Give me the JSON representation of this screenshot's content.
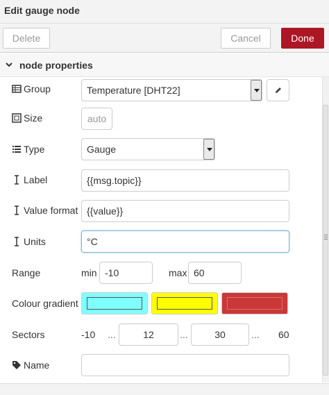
{
  "header": {
    "title": "Edit gauge node"
  },
  "toolbar": {
    "delete_label": "Delete",
    "cancel_label": "Cancel",
    "done_label": "Done"
  },
  "section": {
    "label": "node properties"
  },
  "group": {
    "label": "Group",
    "value": "Temperature [DHT22]"
  },
  "size": {
    "label": "Size",
    "value": "auto"
  },
  "type": {
    "label": "Type",
    "value": "Gauge"
  },
  "label": {
    "label": "Label",
    "value": "{{msg.topic}}"
  },
  "value_format": {
    "label": "Value format",
    "value": "{{value}}"
  },
  "units": {
    "label": "Units",
    "value": "°C"
  },
  "range": {
    "label": "Range",
    "min_label": "min",
    "min_value": "-10",
    "max_label": "max",
    "max_value": "60"
  },
  "colour_gradient": {
    "label": "Colour gradient",
    "colors": [
      "#80ffff",
      "#ffff00",
      "#ca3838"
    ]
  },
  "sectors": {
    "label": "Sectors",
    "start": "-10",
    "sep": "...",
    "seg1": "12",
    "seg2": "30",
    "end": "60"
  },
  "name": {
    "label": "Name",
    "value": ""
  },
  "colors": {
    "done_bg": "#ad1625",
    "focus_border": "#85b7d9"
  }
}
